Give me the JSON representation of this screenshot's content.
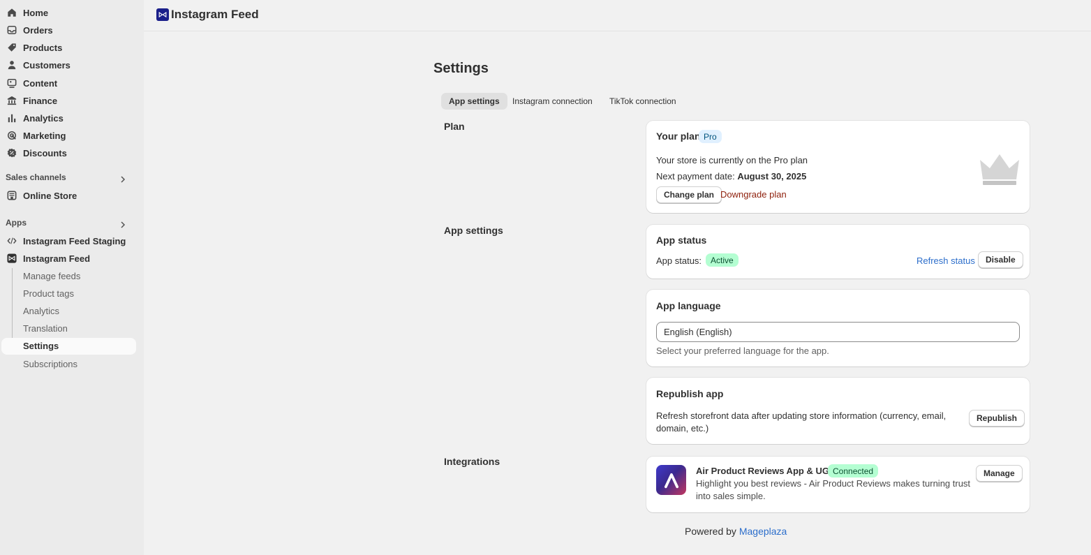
{
  "sidebar": {
    "main_items": [
      {
        "label": "Home",
        "icon": "home-icon"
      },
      {
        "label": "Orders",
        "icon": "inbox-icon"
      },
      {
        "label": "Products",
        "icon": "tag-icon"
      },
      {
        "label": "Customers",
        "icon": "person-icon"
      },
      {
        "label": "Content",
        "icon": "image-icon"
      },
      {
        "label": "Finance",
        "icon": "bank-icon"
      },
      {
        "label": "Analytics",
        "icon": "bar-chart-icon"
      },
      {
        "label": "Marketing",
        "icon": "target-icon"
      },
      {
        "label": "Discounts",
        "icon": "discount-icon"
      }
    ],
    "sales_channels_title": "Sales channels",
    "online_store": "Online Store",
    "apps_title": "Apps",
    "app_staging": "Instagram Feed Staging",
    "app_main": "Instagram Feed",
    "sub_items": [
      "Manage feeds",
      "Product tags",
      "Analytics",
      "Translation",
      "Settings",
      "Subscriptions"
    ]
  },
  "header": {
    "app_title": "Instagram Feed"
  },
  "page": {
    "title": "Settings",
    "tabs": [
      "App settings",
      "Instagram connection",
      "TikTok connection"
    ]
  },
  "plan": {
    "section": "Plan",
    "card_title": "Your plan",
    "badge": "Pro",
    "line1": "Your store is currently on the Pro plan",
    "next_payment_label": "Next payment date: ",
    "next_payment_date": "August 30, 2025",
    "change_plan": "Change plan",
    "downgrade": "Downgrade plan"
  },
  "app_settings": {
    "section": "App settings",
    "status_title": "App status",
    "status_label": "App status:",
    "status_badge": "Active",
    "refresh": "Refresh status",
    "disable": "Disable",
    "language_title": "App language",
    "language_value": "English (English)",
    "language_help": "Select your preferred language for the app.",
    "republish_title": "Republish app",
    "republish_text_1": "Refresh storefront data after updating store information (currency, email,",
    "republish_text_2": "domain, etc.)",
    "republish_button": "Republish"
  },
  "integrations": {
    "section": "Integrations",
    "name": "Air Product Reviews App & UGC",
    "badge": "Connected",
    "desc_1": "Highlight you best reviews - Air Product Reviews makes turning trust",
    "desc_2": "into sales simple.",
    "manage": "Manage"
  },
  "footer": {
    "prefix": "Powered by ",
    "link": "Mageplaza"
  },
  "colors": {
    "pro_badge_bg": "#e0f0ff",
    "active_badge_bg": "#b4fed2",
    "link_blue": "#2c6ecb",
    "critical_red": "#8e1f0b"
  }
}
